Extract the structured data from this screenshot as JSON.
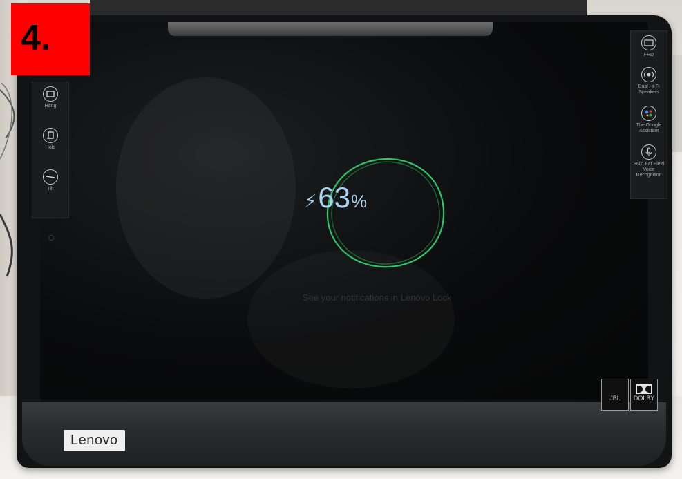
{
  "step_label": "4.",
  "charging": {
    "icon": "lightning-bolt-icon",
    "value": "63",
    "unit": "%",
    "ring_color": "#2ec46a",
    "text_color": "#a9d3f1"
  },
  "left_features": [
    {
      "icon": "hang-icon",
      "label": "Hang"
    },
    {
      "icon": "hold-icon",
      "label": "Hold"
    },
    {
      "icon": "tilt-icon",
      "label": "Tilt"
    }
  ],
  "right_features": [
    {
      "icon": "fhd-icon",
      "label": "FHD"
    },
    {
      "icon": "speaker-icon",
      "label": "Dual Hi-Fi Speakers"
    },
    {
      "icon": "google-assistant-icon",
      "label": "The Google Assistant"
    },
    {
      "icon": "voice-recognition-icon",
      "label": "360° Far Field Voice Recognition"
    }
  ],
  "brand": "Lenovo",
  "badges": {
    "jbl": "JBL",
    "dolby": "DOLBY"
  },
  "colors": {
    "step_badge": "#ff0000"
  }
}
